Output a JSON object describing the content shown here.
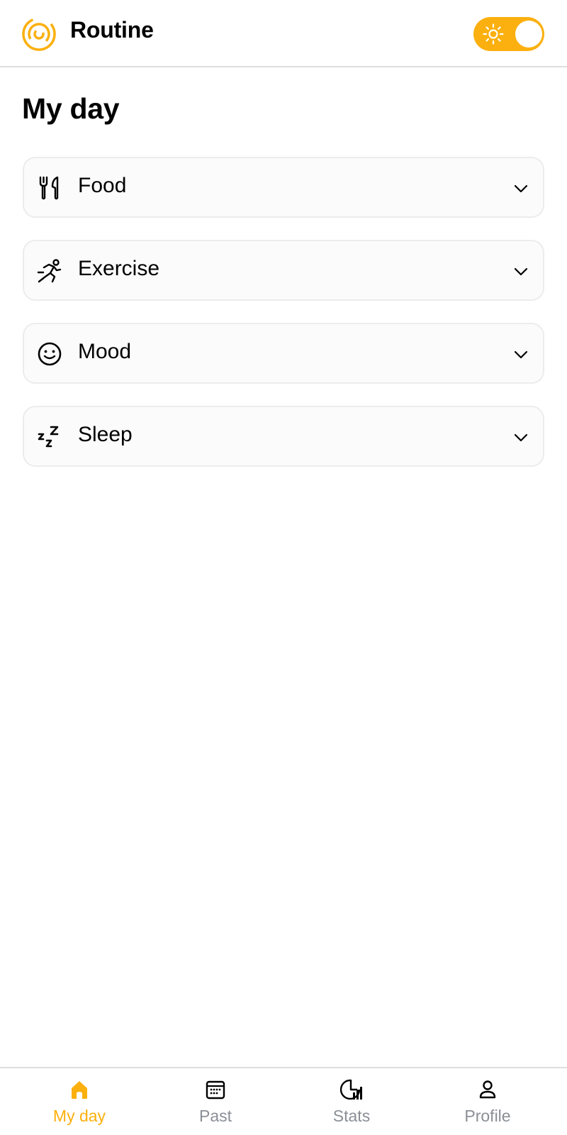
{
  "header": {
    "app_title": "Routine",
    "logo_icon": "swirl-logo",
    "theme_toggle": {
      "icon": "sun-icon",
      "state": "light"
    }
  },
  "page": {
    "title": "My day"
  },
  "sections": [
    {
      "label": "Food",
      "icon": "fork-knife-icon"
    },
    {
      "label": "Exercise",
      "icon": "running-person-icon"
    },
    {
      "label": "Mood",
      "icon": "smiley-icon"
    },
    {
      "label": "Sleep",
      "icon": "zzz-icon"
    }
  ],
  "bottom_nav": [
    {
      "label": "My day",
      "icon": "home-icon",
      "active": true
    },
    {
      "label": "Past",
      "icon": "calendar-icon",
      "active": false
    },
    {
      "label": "Stats",
      "icon": "stats-icon",
      "active": false
    },
    {
      "label": "Profile",
      "icon": "profile-icon",
      "active": false
    }
  ],
  "colors": {
    "accent": "#FBB00F",
    "inactive": "#8a8f96",
    "card_bg": "#fbfbfb",
    "border": "#ececec"
  }
}
